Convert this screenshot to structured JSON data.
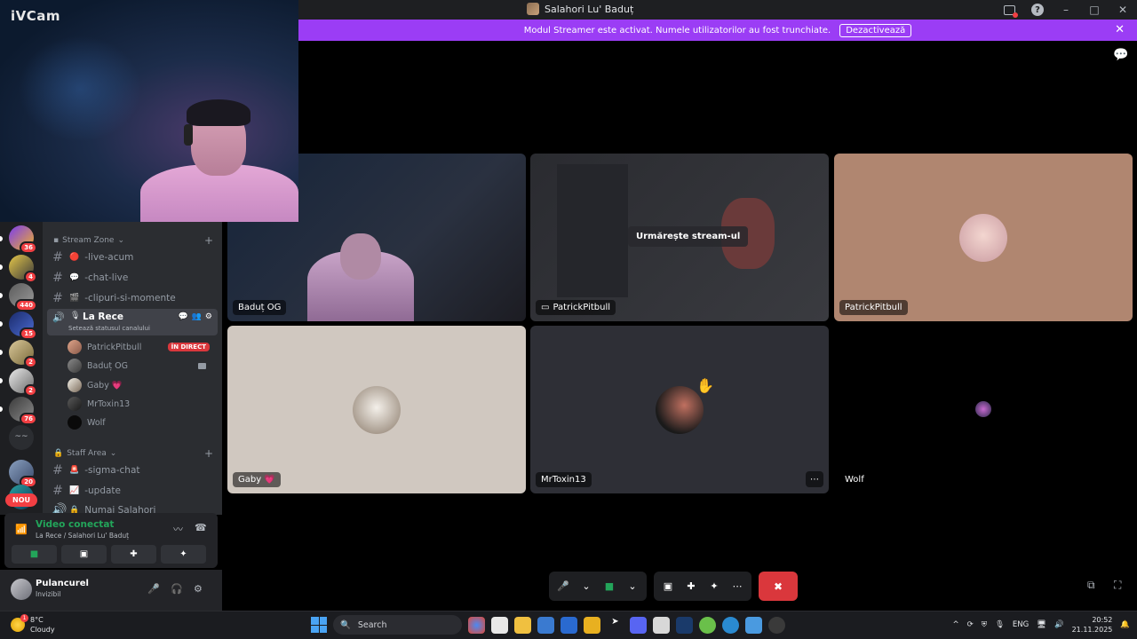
{
  "window": {
    "title": "Salahori Lu' Baduț"
  },
  "banner": {
    "text": "Modul Streamer este activat. Numele utilizatorilor au fost trunchiate.",
    "button": "Dezactivează"
  },
  "webcam": {
    "logo": "iVCam"
  },
  "rail": {
    "badges": [
      "36",
      "4",
      "440",
      "15",
      "2",
      "2",
      "76",
      "20"
    ],
    "new_label": "NOU"
  },
  "channels": {
    "stream_zone": "Stream Zone",
    "staff_area": "Staff Area",
    "list": [
      {
        "name": "-live-acum",
        "emoji": "🔴"
      },
      {
        "name": "-chat-live",
        "emoji": "💬"
      },
      {
        "name": "-clipuri-si-momente",
        "emoji": "🎬"
      }
    ],
    "voice": {
      "name": "La Rece",
      "status": "Setează statusul canalului"
    },
    "voice_users": [
      {
        "name": "PatrickPitbull",
        "live": "ÎN DIRECT"
      },
      {
        "name": "Baduț OG"
      },
      {
        "name": "Gaby 💗"
      },
      {
        "name": "MrToxin13"
      },
      {
        "name": "Wolf"
      }
    ],
    "staff": [
      {
        "name": "-sigma-chat",
        "emoji": "🚨"
      },
      {
        "name": "-update",
        "emoji": "📈"
      },
      {
        "name": "Numai Salahori",
        "emoji": "🔒"
      }
    ]
  },
  "vpanel": {
    "title": "Video conectat",
    "sub": "La Rece / Salahori Lu' Baduț"
  },
  "user": {
    "name": "Pulancurel",
    "status": "Invizibil"
  },
  "tiles": [
    {
      "name": "Baduț OG"
    },
    {
      "name": "PatrickPitbull",
      "watch": "Urmărește stream-ul"
    },
    {
      "name": "PatrickPitbull"
    },
    {
      "name": "Gaby 💗"
    },
    {
      "name": "MrToxin13"
    },
    {
      "name": "Wolf"
    }
  ],
  "taskbar": {
    "temp": "8°C",
    "weather": "Cloudy",
    "search": "Search",
    "lang": "ENG",
    "time": "20:52",
    "date": "21.11.2025"
  }
}
